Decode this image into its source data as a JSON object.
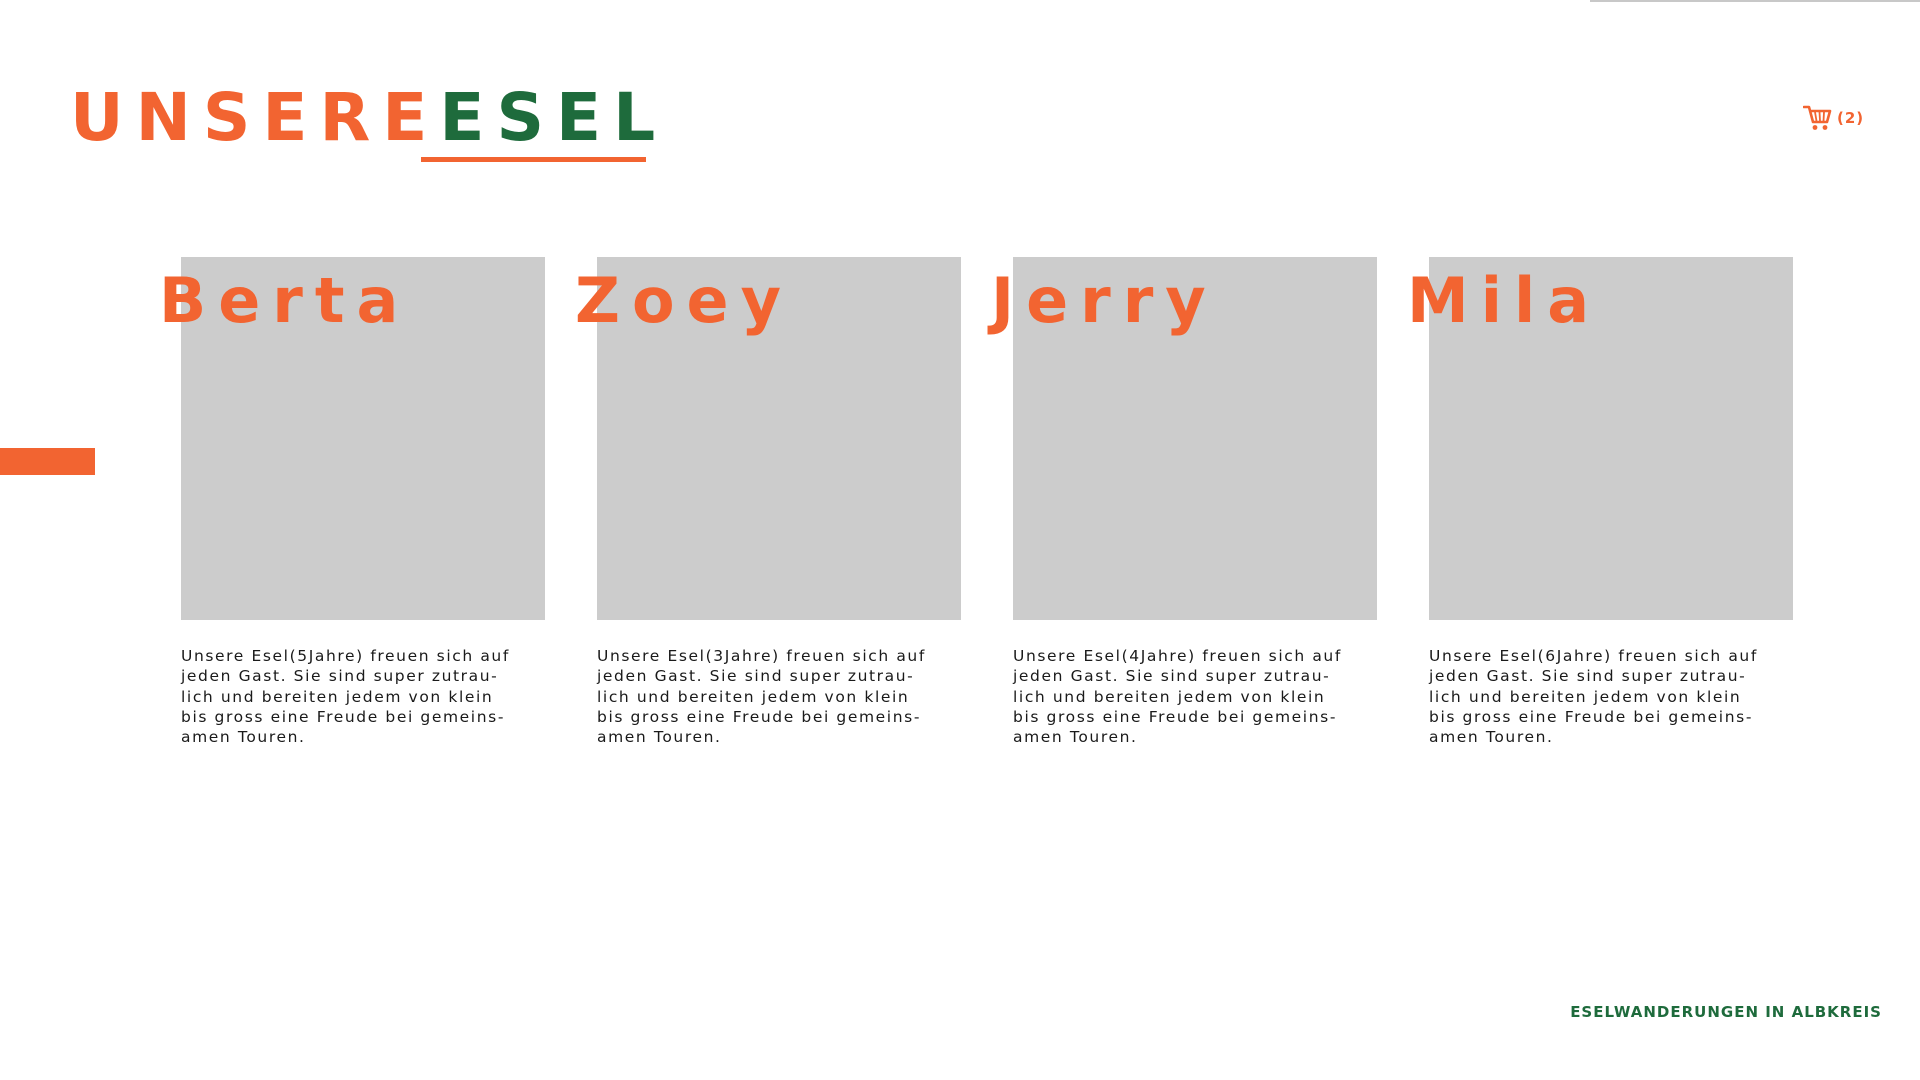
{
  "header": {
    "title_part1": "UNSERE",
    "title_part2": "ESEL",
    "cart_count": "(2)",
    "cart_icon": "shopping-cart-icon"
  },
  "colors": {
    "accent": "#f26431",
    "brand_green": "#1e6b3c",
    "placeholder_gray": "#cccccc"
  },
  "donkeys": [
    {
      "name": "Berta",
      "description": "Unsere Esel(5Jahre) freuen sich auf\njeden Gast. Sie sind super zutrau-\nlich und bereiten jedem von klein\nbis gross eine Freude bei gemeins-\namen Touren."
    },
    {
      "name": "Zoey",
      "description": "Unsere Esel(3Jahre) freuen sich auf\njeden Gast. Sie sind super zutrau-\nlich und bereiten jedem von klein\nbis gross eine Freude bei gemeins-\namen Touren."
    },
    {
      "name": "Jerry",
      "description": "Unsere Esel(4Jahre) freuen sich auf\njeden Gast. Sie sind super zutrau-\nlich und bereiten jedem von klein\nbis gross eine Freude bei gemeins-\namen Touren."
    },
    {
      "name": "Mila",
      "description": "Unsere Esel(6Jahre) freuen sich auf\njeden Gast. Sie sind super zutrau-\nlich und bereiten jedem von klein\nbis gross eine Freude bei gemeins-\namen Touren."
    }
  ],
  "footer": {
    "text": "ESELWANDERUNGEN IN ALBKREIS"
  }
}
